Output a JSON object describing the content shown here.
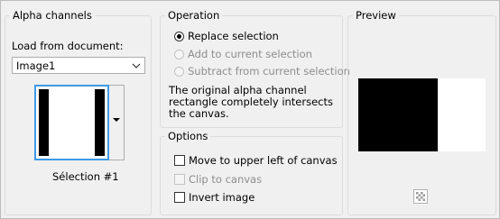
{
  "alpha_channels": {
    "title": "Alpha channels",
    "load_label": "Load from document:",
    "document_value": "Image1",
    "selection_name": "Sélection #1"
  },
  "operation": {
    "title": "Operation",
    "options": [
      {
        "label": "Replace selection",
        "checked": true,
        "enabled": true
      },
      {
        "label": "Add to current selection",
        "checked": false,
        "enabled": false
      },
      {
        "label": "Subtract from current selection",
        "checked": false,
        "enabled": false
      }
    ],
    "description": "The original alpha channel rectangle completely intersects the canvas."
  },
  "options_group": {
    "title": "Options",
    "move_label": "Move to upper left of canvas",
    "clip_label": "Clip to canvas",
    "invert_label": "Invert image"
  },
  "preview": {
    "title": "Preview",
    "toggle_icon": "checkerboard-icon"
  },
  "colors": {
    "accent": "#3d9ae8",
    "disabled_text": "#8d8d8d"
  }
}
